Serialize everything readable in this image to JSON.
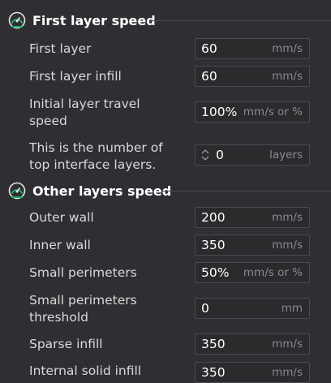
{
  "sections": [
    {
      "title": "First layer speed",
      "icon": "speedometer-icon",
      "rows": [
        {
          "label": "First layer",
          "value": "60",
          "unit": "mm/s"
        },
        {
          "label": "First layer infill",
          "value": "60",
          "unit": "mm/s"
        },
        {
          "label": "Initial layer travel speed",
          "value": "100%",
          "unit": "mm/s or %"
        },
        {
          "label": "This is the number of top interface layers.",
          "value": "0",
          "unit": "layers"
        }
      ]
    },
    {
      "title": "Other layers speed",
      "icon": "speedometer-icon",
      "rows": [
        {
          "label": "Outer wall",
          "value": "200",
          "unit": "mm/s"
        },
        {
          "label": "Inner wall",
          "value": "350",
          "unit": "mm/s"
        },
        {
          "label": "Small perimeters",
          "value": "50%",
          "unit": "mm/s or %"
        },
        {
          "label": "Small perimeters threshold",
          "value": "0",
          "unit": "mm"
        },
        {
          "label": "Sparse infill",
          "value": "350",
          "unit": "mm/s"
        },
        {
          "label": "Internal solid infill",
          "value": "350",
          "unit": "mm/s"
        }
      ]
    }
  ],
  "colors": {
    "background": "#2f2f33",
    "field_border": "#4a4a4f",
    "icon_green": "#1fae6a"
  }
}
